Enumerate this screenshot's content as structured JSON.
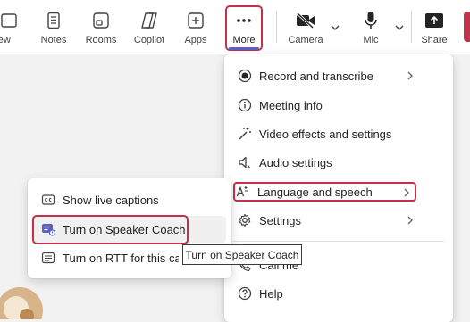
{
  "toolbar": {
    "view_label": "View",
    "notes_label": "Notes",
    "rooms_label": "Rooms",
    "copilot_label": "Copilot",
    "apps_label": "Apps",
    "more_label": "More",
    "camera_label": "Camera",
    "mic_label": "Mic",
    "share_label": "Share"
  },
  "more_menu": {
    "items": [
      {
        "label": "Record and transcribe",
        "icon": "record-icon",
        "has_submenu": true
      },
      {
        "label": "Meeting info",
        "icon": "info-icon",
        "has_submenu": false
      },
      {
        "label": "Video effects and settings",
        "icon": "magic-wand-icon",
        "has_submenu": false
      },
      {
        "label": "Audio settings",
        "icon": "speaker-icon",
        "has_submenu": false
      },
      {
        "label": "Language and speech",
        "icon": "language-icon",
        "has_submenu": true
      },
      {
        "label": "Settings",
        "icon": "gear-icon",
        "has_submenu": true
      },
      {
        "label": "Call me",
        "icon": "phone-icon",
        "has_submenu": false
      },
      {
        "label": "Help",
        "icon": "help-icon",
        "has_submenu": false
      }
    ]
  },
  "language_submenu": {
    "items": [
      {
        "label": "Show live captions",
        "icon": "captions-icon"
      },
      {
        "label": "Turn on Speaker Coach",
        "icon": "speaker-coach-icon"
      },
      {
        "label": "Turn on RTT for this call",
        "icon": "rtt-icon"
      }
    ]
  },
  "tooltip": {
    "text": "Turn on Speaker Coach"
  },
  "colors": {
    "highlight_outline": "#c4314b",
    "accent": "#5b5fc7"
  }
}
